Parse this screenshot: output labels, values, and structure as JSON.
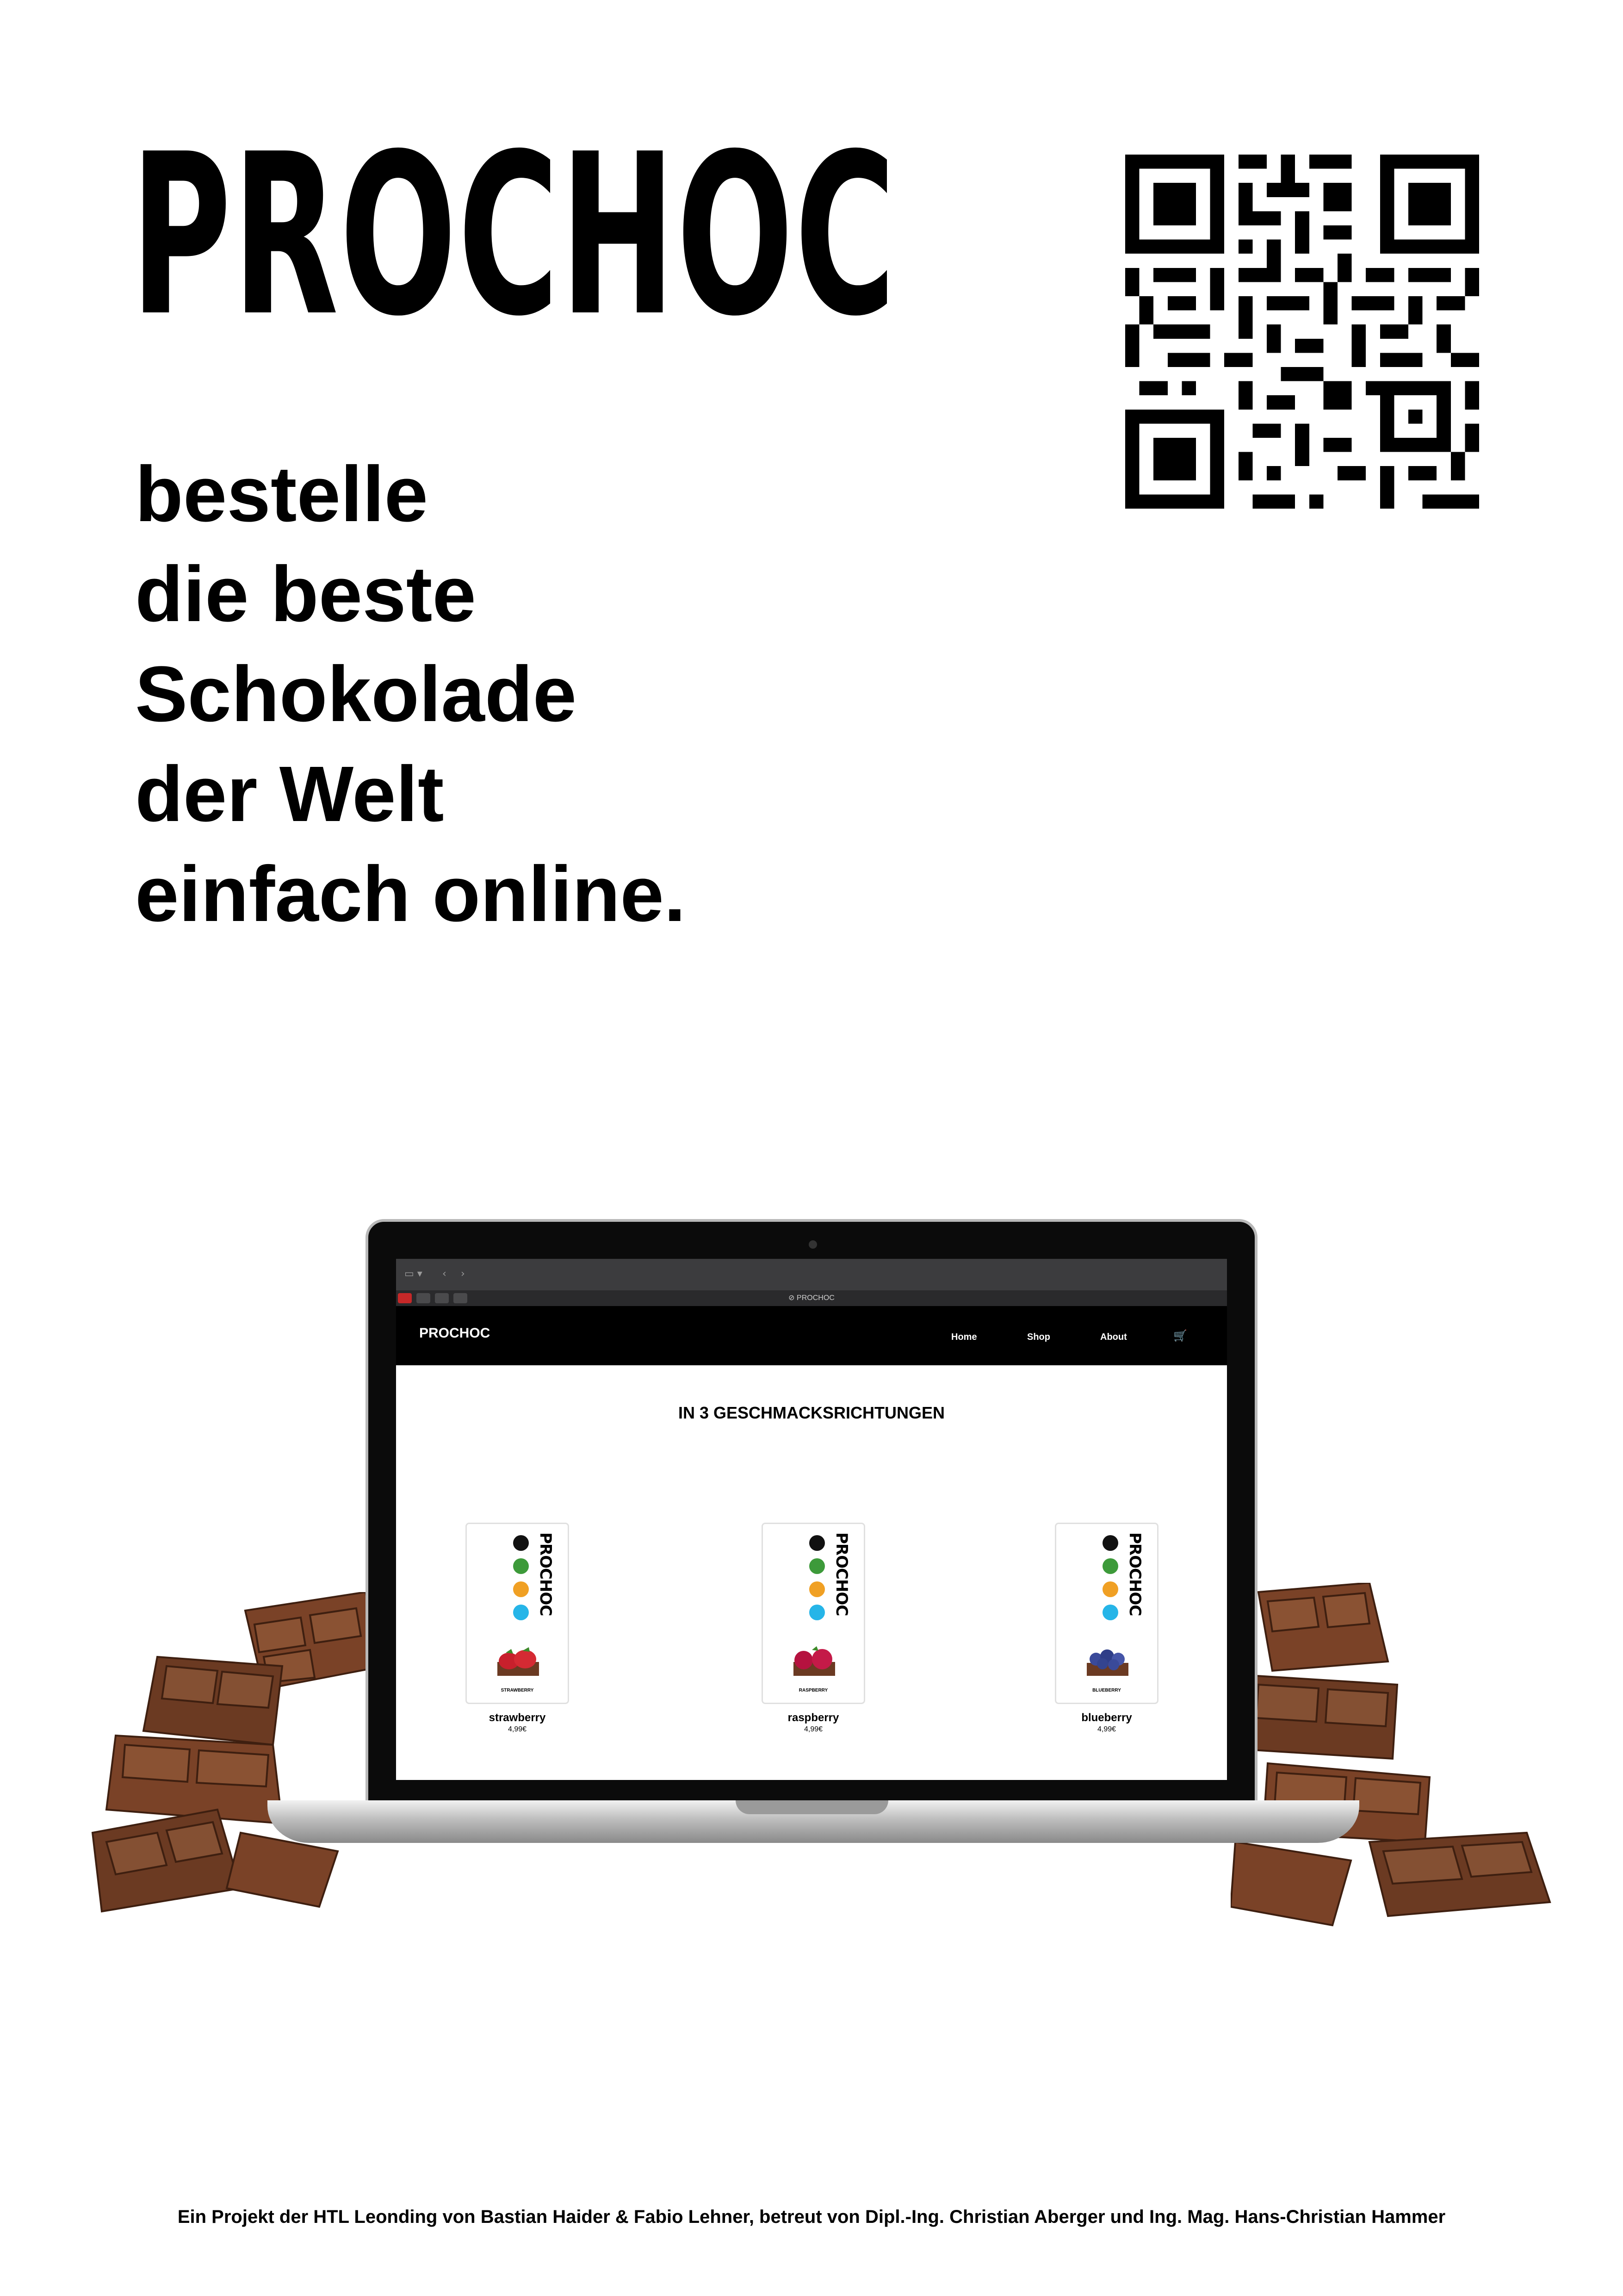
{
  "poster": {
    "brand": "PROCHOC",
    "tagline": [
      "bestelle",
      "die beste",
      "Schokolade",
      "der Welt",
      "einfach online."
    ],
    "footer": "Ein Projekt der HTL Leonding von Bastian Haider & Fabio Lehner, betreut von Dipl.-Ing. Christian Aberger und Ing. Mag. Hans-Christian Hammer"
  },
  "browser": {
    "tab_title": "PROCHOC",
    "icons": [
      "sidebar-icon",
      "back-icon",
      "forward-icon",
      "lock-icon"
    ]
  },
  "site": {
    "logo": "PROCHOC",
    "nav": [
      "Home",
      "Shop",
      "About"
    ],
    "cart_icon": "cart-icon",
    "section_title": "IN 3 GESCHMACKSRICHTUNGEN",
    "products": [
      {
        "name": "strawberry",
        "price": "4,99€",
        "pack_label": "STRAWBERRY",
        "fruit_color": "#c8202c"
      },
      {
        "name": "raspberry",
        "price": "4,99€",
        "pack_label": "RASPBERRY",
        "fruit_color": "#b5123f"
      },
      {
        "name": "blueberry",
        "price": "4,99€",
        "pack_label": "BLUEBERRY",
        "fruit_color": "#3a4a9a"
      }
    ],
    "pack_brand": "PROCHOC",
    "badge_colors": [
      "#111111",
      "#3d9a3a",
      "#f0a024",
      "#26b5e8"
    ]
  },
  "colors": {
    "chocolate": "#6b3a22",
    "chocolate_light": "#8a5233",
    "header": "#000000"
  }
}
